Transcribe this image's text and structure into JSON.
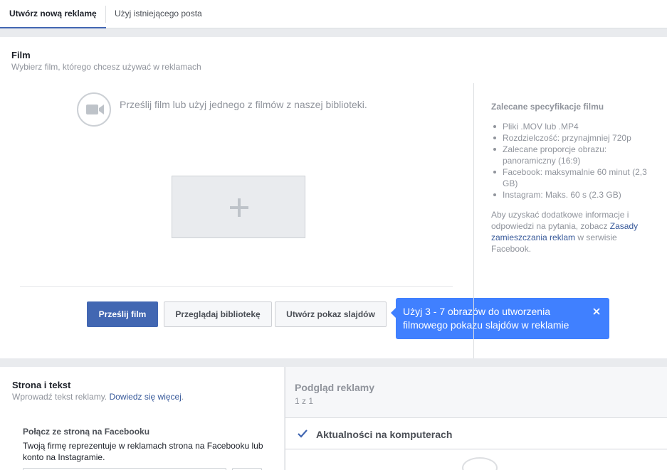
{
  "tabs": [
    {
      "label": "Utwórz nową reklamę",
      "active": true
    },
    {
      "label": "Użyj istniejącego posta",
      "active": false
    }
  ],
  "film": {
    "title": "Film",
    "subtitle": "Wybierz film, którego chcesz używać w reklamach",
    "upload_message": "Prześlij film lub użyj jednego z filmów z naszej biblioteki.",
    "buttons": {
      "upload": "Prześlij film",
      "browse": "Przeglądaj bibliotekę",
      "slideshow": "Utwórz pokaz slajdów"
    },
    "tooltip": "Użyj 3 - 7 obrazów do utworzenia filmowego pokazu slajdów w reklamie"
  },
  "specs": {
    "title": "Zalecane specyfikacje filmu",
    "items": [
      "Pliki .MOV lub .MP4",
      "Rozdzielczość: przynajmniej 720p",
      "Zalecane proporcje obrazu: panoramiczny (16:9)",
      "Facebook: maksymalnie 60 minut (2,3 GB)",
      "Instagram: Maks. 60 s (2.3 GB)"
    ],
    "info_before": "Aby uzyskać dodatkowe informacje i odpowiedzi na pytania, zobacz ",
    "info_link": "Zasady zamieszczania reklam",
    "info_after": " w serwisie Facebook."
  },
  "page_text": {
    "title": "Strona i tekst",
    "subtitle": "Wprowadź tekst reklamy.",
    "learn_more": "Dowiedz się więcej",
    "subtitle_end": ".",
    "connect_label": "Połącz ze stroną na Facebooku",
    "connect_desc": "Twoją firmę reprezentuje w reklamach strona na Facebooku lub konto na Instagramie."
  },
  "preview": {
    "title": "Podgląd reklamy",
    "count": "1 z 1",
    "placement": "Aktualności na komputerach"
  },
  "colors": {
    "primary": "#4267b2",
    "tooltip": "#4080ff",
    "link": "#365899",
    "muted": "#90949c"
  }
}
